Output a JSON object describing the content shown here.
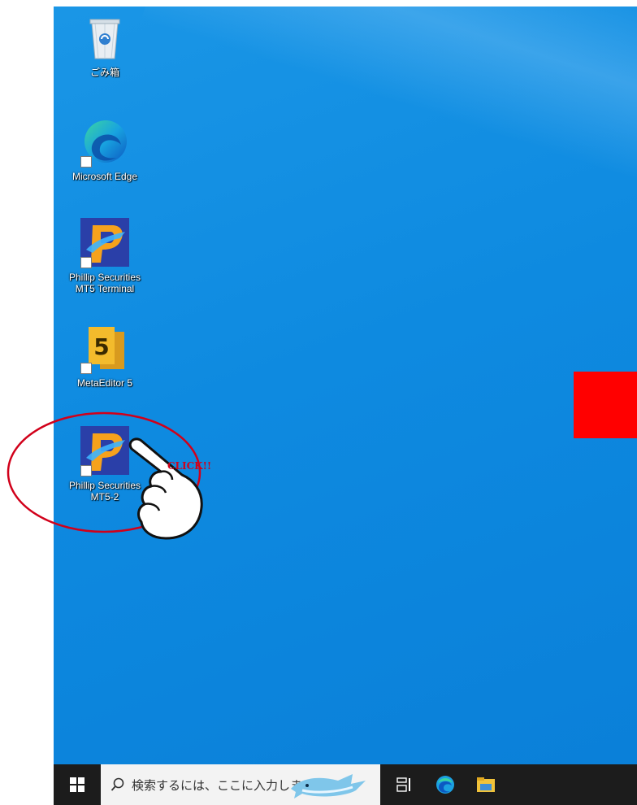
{
  "desktop": {
    "icons": [
      {
        "label": "ごみ箱",
        "icon": "recycle-bin-icon"
      },
      {
        "label": "Microsoft Edge",
        "icon": "edge-icon"
      },
      {
        "label": "Phillip Securities\nMT5 Terminal",
        "icon": "phillip-securities-icon"
      },
      {
        "label": "MetaEditor 5",
        "icon": "metaeditor-icon"
      },
      {
        "label": "Phillip Securities\nMT5-2",
        "icon": "phillip-securities-icon"
      }
    ]
  },
  "annotation": {
    "click_text": "CLICK!!",
    "circle_color": "#d1001a",
    "pointer": "pointing-hand-icon"
  },
  "taskbar": {
    "start": "windows-start-icon",
    "search_placeholder": "検索するには、ここに入力します",
    "search_icon": "search-icon",
    "items": [
      "task-view-icon",
      "edge-icon",
      "file-explorer-icon"
    ]
  },
  "colors": {
    "desktop_bg": "#0e8ae0",
    "taskbar_bg": "#1c1c1c",
    "red_block": "#ff0000"
  }
}
